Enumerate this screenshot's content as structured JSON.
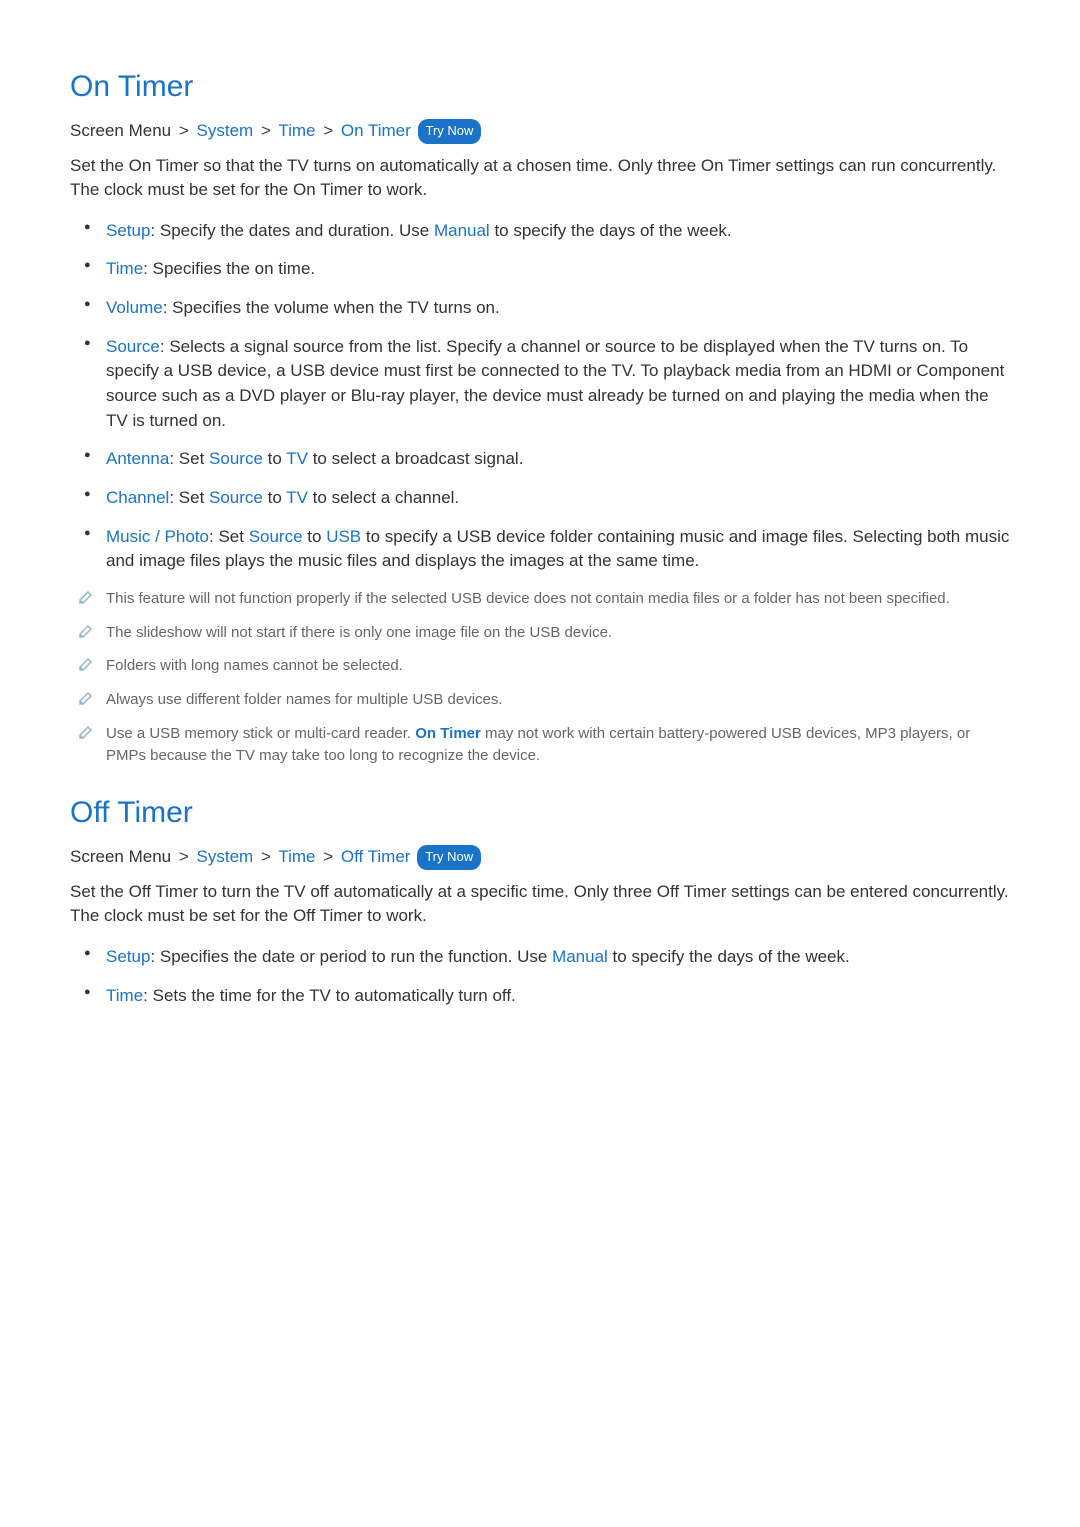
{
  "sections": [
    {
      "title": "On Timer",
      "breadcrumb": {
        "prefix": "Screen Menu",
        "parts": [
          "System",
          "Time",
          "On Timer"
        ],
        "try_now": "Try Now"
      },
      "description": "Set the On Timer so that the TV turns on automatically at a chosen time. Only three On Timer settings can run concurrently. The clock must be set for the On Timer to work.",
      "bullets": [
        {
          "label": "Setup",
          "pre_text": ": Specify the dates and duration. Use ",
          "inline_key": "Manual",
          "post_text": " to specify the days of the week."
        },
        {
          "label": "Time",
          "pre_text": ": Specifies the on time.",
          "inline_key": "",
          "post_text": ""
        },
        {
          "label": "Volume",
          "pre_text": ": Specifies the volume when the TV turns on.",
          "inline_key": "",
          "post_text": ""
        },
        {
          "label": "Source",
          "pre_text": ": Selects a signal source from the list. Specify a channel or source to be displayed when the TV turns on. To specify a USB device, a USB device must first be connected to the TV. To playback media from an HDMI or Component source such as a DVD player or Blu-ray player, the device must already be turned on and playing the media when the TV is turned on.",
          "inline_key": "",
          "post_text": ""
        },
        {
          "label": "Antenna",
          "pre_text": ": Set ",
          "inline_key": "Source",
          "post_text_mid": " to ",
          "inline_key2": "TV",
          "post_text": " to select a broadcast signal."
        },
        {
          "label": "Channel",
          "pre_text": ": Set ",
          "inline_key": "Source",
          "post_text_mid": " to ",
          "inline_key2": "TV",
          "post_text": " to select a channel."
        },
        {
          "label": "Music / Photo",
          "pre_text": ": Set ",
          "inline_key": "Source",
          "post_text_mid": " to ",
          "inline_key2": "USB",
          "post_text": " to specify a USB device folder containing music and image files. Selecting both music and image files plays the music files and displays the images at the same time."
        }
      ],
      "notes": [
        {
          "pre": "This feature will not function properly if the selected USB device does not contain media files or a folder has not been specified.",
          "key": "",
          "post": ""
        },
        {
          "pre": "The slideshow will not start if there is only one image file on the USB device.",
          "key": "",
          "post": ""
        },
        {
          "pre": "Folders with long names cannot be selected.",
          "key": "",
          "post": ""
        },
        {
          "pre": "Always use different folder names for multiple USB devices.",
          "key": "",
          "post": ""
        },
        {
          "pre": "Use a USB memory stick or multi-card reader. ",
          "key": "On Timer",
          "post": " may not work with certain battery-powered USB devices, MP3 players, or PMPs because the TV may take too long to recognize the device."
        }
      ]
    },
    {
      "title": "Off Timer",
      "breadcrumb": {
        "prefix": "Screen Menu",
        "parts": [
          "System",
          "Time",
          "Off Timer"
        ],
        "try_now": "Try Now"
      },
      "description": "Set the Off Timer to turn the TV off automatically at a specific time. Only three Off Timer settings can be entered concurrently. The clock must be set for the Off Timer to work.",
      "bullets": [
        {
          "label": "Setup",
          "pre_text": ": Specifies the date or period to run the function. Use ",
          "inline_key": "Manual",
          "post_text": " to specify the days of the week."
        },
        {
          "label": "Time",
          "pre_text": ": Sets the time for the TV to automatically turn off.",
          "inline_key": "",
          "post_text": ""
        }
      ],
      "notes": []
    }
  ],
  "sep_glyph": ">"
}
